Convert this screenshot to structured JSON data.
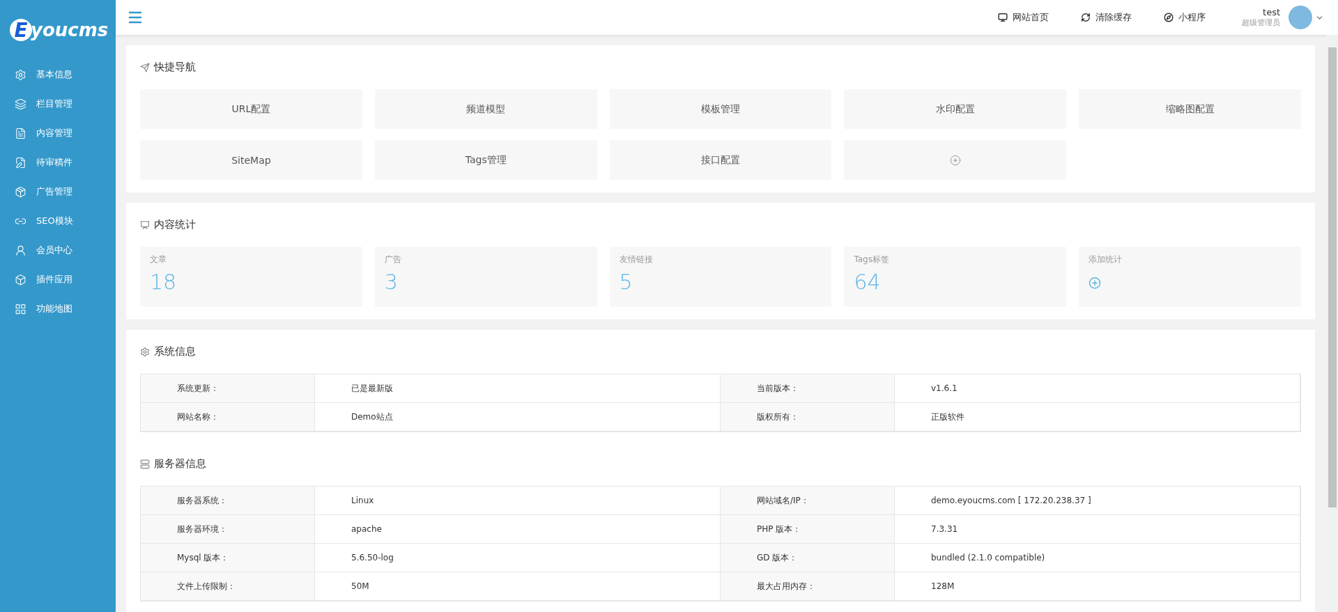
{
  "logo": {
    "badge": "E",
    "text": "youcms"
  },
  "sidebar": {
    "items": [
      {
        "label": "基本信息"
      },
      {
        "label": "栏目管理"
      },
      {
        "label": "内容管理"
      },
      {
        "label": "待审稿件"
      },
      {
        "label": "广告管理"
      },
      {
        "label": "SEO模块"
      },
      {
        "label": "会员中心"
      },
      {
        "label": "插件应用"
      },
      {
        "label": "功能地图"
      }
    ]
  },
  "header": {
    "links": [
      {
        "label": "网站首页"
      },
      {
        "label": "清除缓存"
      },
      {
        "label": "小程序"
      }
    ],
    "user": {
      "name": "test",
      "role": "超级管理员"
    }
  },
  "quick_nav": {
    "title": "快捷导航",
    "items": [
      {
        "kind": "text",
        "label": "URL配置"
      },
      {
        "kind": "text",
        "label": "频道模型"
      },
      {
        "kind": "text",
        "label": "模板管理"
      },
      {
        "kind": "text",
        "label": "水印配置"
      },
      {
        "kind": "text",
        "label": "缩略图配置"
      },
      {
        "kind": "text",
        "label": "SiteMap"
      },
      {
        "kind": "text",
        "label": "Tags管理"
      },
      {
        "kind": "text",
        "label": "接口配置"
      },
      {
        "kind": "add"
      }
    ]
  },
  "stats": {
    "title": "内容统计",
    "items": [
      {
        "kind": "count",
        "label": "文章",
        "value": "18"
      },
      {
        "kind": "count",
        "label": "广告",
        "value": "3"
      },
      {
        "kind": "count",
        "label": "友情链接",
        "value": "5"
      },
      {
        "kind": "count",
        "label": "Tags标签",
        "value": "64"
      },
      {
        "kind": "add",
        "label": "添加统计"
      }
    ]
  },
  "system_info": {
    "title": "系统信息",
    "rows": [
      [
        "系统更新：",
        "已是最新版",
        "当前版本：",
        "v1.6.1"
      ],
      [
        "网站名称：",
        "Demo站点",
        "版权所有：",
        "正版软件"
      ]
    ]
  },
  "server_info": {
    "title": "服务器信息",
    "rows": [
      [
        "服务器系统：",
        "Linux",
        "网站域名/IP：",
        "demo.eyoucms.com [ 172.20.238.37 ]"
      ],
      [
        "服务器环境：",
        "apache",
        "PHP 版本：",
        "7.3.31"
      ],
      [
        "Mysql 版本：",
        "5.6.50-log",
        "GD 版本：",
        "bundled (2.1.0 compatible)"
      ],
      [
        "文件上传限制：",
        "50M",
        "最大占用内存：",
        "128M"
      ]
    ]
  }
}
